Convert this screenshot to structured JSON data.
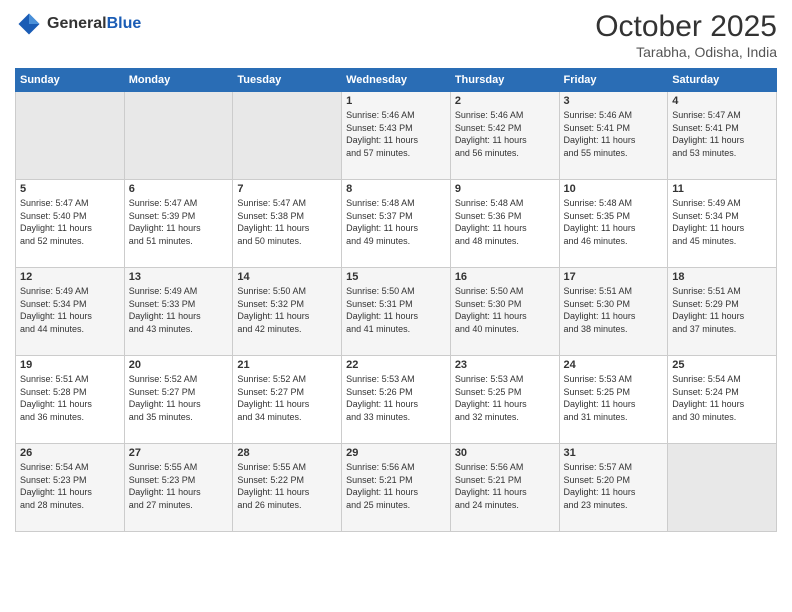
{
  "header": {
    "logo_general": "General",
    "logo_blue": "Blue",
    "month": "October 2025",
    "location": "Tarabha, Odisha, India"
  },
  "days_of_week": [
    "Sunday",
    "Monday",
    "Tuesday",
    "Wednesday",
    "Thursday",
    "Friday",
    "Saturday"
  ],
  "weeks": [
    [
      {
        "day": "",
        "info": ""
      },
      {
        "day": "",
        "info": ""
      },
      {
        "day": "",
        "info": ""
      },
      {
        "day": "1",
        "info": "Sunrise: 5:46 AM\nSunset: 5:43 PM\nDaylight: 11 hours\nand 57 minutes."
      },
      {
        "day": "2",
        "info": "Sunrise: 5:46 AM\nSunset: 5:42 PM\nDaylight: 11 hours\nand 56 minutes."
      },
      {
        "day": "3",
        "info": "Sunrise: 5:46 AM\nSunset: 5:41 PM\nDaylight: 11 hours\nand 55 minutes."
      },
      {
        "day": "4",
        "info": "Sunrise: 5:47 AM\nSunset: 5:41 PM\nDaylight: 11 hours\nand 53 minutes."
      }
    ],
    [
      {
        "day": "5",
        "info": "Sunrise: 5:47 AM\nSunset: 5:40 PM\nDaylight: 11 hours\nand 52 minutes."
      },
      {
        "day": "6",
        "info": "Sunrise: 5:47 AM\nSunset: 5:39 PM\nDaylight: 11 hours\nand 51 minutes."
      },
      {
        "day": "7",
        "info": "Sunrise: 5:47 AM\nSunset: 5:38 PM\nDaylight: 11 hours\nand 50 minutes."
      },
      {
        "day": "8",
        "info": "Sunrise: 5:48 AM\nSunset: 5:37 PM\nDaylight: 11 hours\nand 49 minutes."
      },
      {
        "day": "9",
        "info": "Sunrise: 5:48 AM\nSunset: 5:36 PM\nDaylight: 11 hours\nand 48 minutes."
      },
      {
        "day": "10",
        "info": "Sunrise: 5:48 AM\nSunset: 5:35 PM\nDaylight: 11 hours\nand 46 minutes."
      },
      {
        "day": "11",
        "info": "Sunrise: 5:49 AM\nSunset: 5:34 PM\nDaylight: 11 hours\nand 45 minutes."
      }
    ],
    [
      {
        "day": "12",
        "info": "Sunrise: 5:49 AM\nSunset: 5:34 PM\nDaylight: 11 hours\nand 44 minutes."
      },
      {
        "day": "13",
        "info": "Sunrise: 5:49 AM\nSunset: 5:33 PM\nDaylight: 11 hours\nand 43 minutes."
      },
      {
        "day": "14",
        "info": "Sunrise: 5:50 AM\nSunset: 5:32 PM\nDaylight: 11 hours\nand 42 minutes."
      },
      {
        "day": "15",
        "info": "Sunrise: 5:50 AM\nSunset: 5:31 PM\nDaylight: 11 hours\nand 41 minutes."
      },
      {
        "day": "16",
        "info": "Sunrise: 5:50 AM\nSunset: 5:30 PM\nDaylight: 11 hours\nand 40 minutes."
      },
      {
        "day": "17",
        "info": "Sunrise: 5:51 AM\nSunset: 5:30 PM\nDaylight: 11 hours\nand 38 minutes."
      },
      {
        "day": "18",
        "info": "Sunrise: 5:51 AM\nSunset: 5:29 PM\nDaylight: 11 hours\nand 37 minutes."
      }
    ],
    [
      {
        "day": "19",
        "info": "Sunrise: 5:51 AM\nSunset: 5:28 PM\nDaylight: 11 hours\nand 36 minutes."
      },
      {
        "day": "20",
        "info": "Sunrise: 5:52 AM\nSunset: 5:27 PM\nDaylight: 11 hours\nand 35 minutes."
      },
      {
        "day": "21",
        "info": "Sunrise: 5:52 AM\nSunset: 5:27 PM\nDaylight: 11 hours\nand 34 minutes."
      },
      {
        "day": "22",
        "info": "Sunrise: 5:53 AM\nSunset: 5:26 PM\nDaylight: 11 hours\nand 33 minutes."
      },
      {
        "day": "23",
        "info": "Sunrise: 5:53 AM\nSunset: 5:25 PM\nDaylight: 11 hours\nand 32 minutes."
      },
      {
        "day": "24",
        "info": "Sunrise: 5:53 AM\nSunset: 5:25 PM\nDaylight: 11 hours\nand 31 minutes."
      },
      {
        "day": "25",
        "info": "Sunrise: 5:54 AM\nSunset: 5:24 PM\nDaylight: 11 hours\nand 30 minutes."
      }
    ],
    [
      {
        "day": "26",
        "info": "Sunrise: 5:54 AM\nSunset: 5:23 PM\nDaylight: 11 hours\nand 28 minutes."
      },
      {
        "day": "27",
        "info": "Sunrise: 5:55 AM\nSunset: 5:23 PM\nDaylight: 11 hours\nand 27 minutes."
      },
      {
        "day": "28",
        "info": "Sunrise: 5:55 AM\nSunset: 5:22 PM\nDaylight: 11 hours\nand 26 minutes."
      },
      {
        "day": "29",
        "info": "Sunrise: 5:56 AM\nSunset: 5:21 PM\nDaylight: 11 hours\nand 25 minutes."
      },
      {
        "day": "30",
        "info": "Sunrise: 5:56 AM\nSunset: 5:21 PM\nDaylight: 11 hours\nand 24 minutes."
      },
      {
        "day": "31",
        "info": "Sunrise: 5:57 AM\nSunset: 5:20 PM\nDaylight: 11 hours\nand 23 minutes."
      },
      {
        "day": "",
        "info": ""
      }
    ]
  ]
}
